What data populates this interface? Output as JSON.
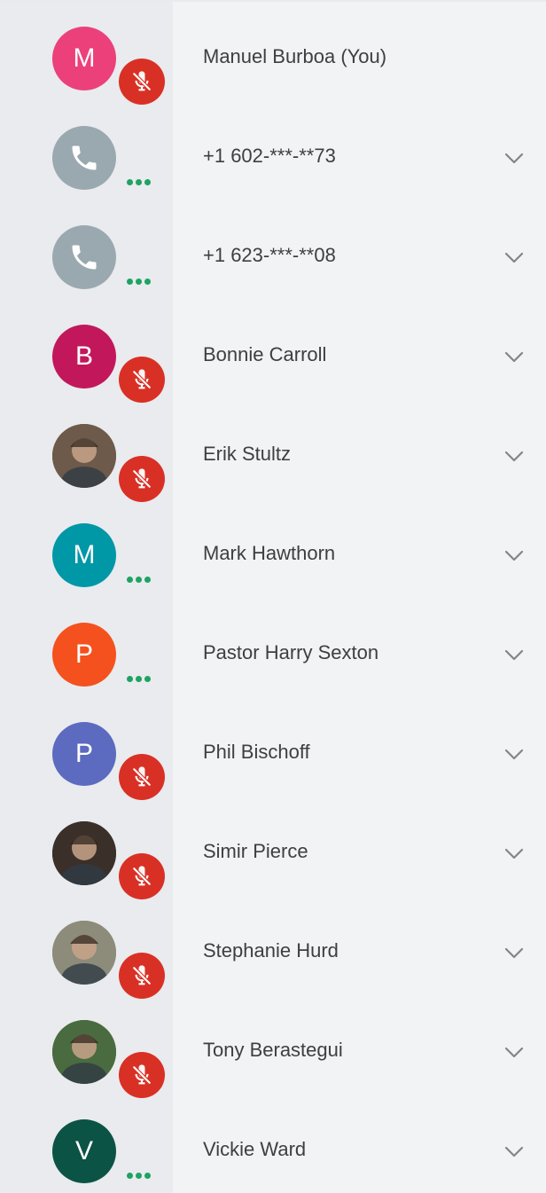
{
  "colors": {
    "panel_bg": "#f1f3f4",
    "gutter_bg": "#e9ebee",
    "muted_red": "#d93025",
    "talking_green": "#1ea362",
    "phone_gray": "#9aa9b0"
  },
  "participants": [
    {
      "name": "Manuel Burboa (You)",
      "avatar_type": "letter",
      "initial": "M",
      "avatar_color": "#ec407a",
      "status": "muted",
      "menu": false
    },
    {
      "name": "+1 602-***-**73",
      "avatar_type": "phone",
      "initial": "",
      "avatar_color": "#9aa9b0",
      "status": "connecting",
      "menu": true
    },
    {
      "name": "+1 623-***-**08",
      "avatar_type": "phone",
      "initial": "",
      "avatar_color": "#9aa9b0",
      "status": "connecting",
      "menu": true
    },
    {
      "name": "Bonnie Carroll",
      "avatar_type": "letter",
      "initial": "B",
      "avatar_color": "#c2185b",
      "status": "muted",
      "menu": true
    },
    {
      "name": "Erik Stultz",
      "avatar_type": "photo",
      "initial": "",
      "avatar_color": "#6d5a4a",
      "status": "muted",
      "menu": true
    },
    {
      "name": "Mark Hawthorn",
      "avatar_type": "letter",
      "initial": "M",
      "avatar_color": "#0097a7",
      "status": "connecting",
      "menu": true
    },
    {
      "name": "Pastor Harry Sexton",
      "avatar_type": "letter",
      "initial": "P",
      "avatar_color": "#f4511e",
      "status": "connecting",
      "menu": true
    },
    {
      "name": "Phil Bischoff",
      "avatar_type": "letter",
      "initial": "P",
      "avatar_color": "#5c6bc0",
      "status": "muted",
      "menu": true
    },
    {
      "name": "Simir Pierce",
      "avatar_type": "photo",
      "initial": "",
      "avatar_color": "#3b2f2a",
      "status": "muted",
      "menu": true
    },
    {
      "name": "Stephanie Hurd",
      "avatar_type": "photo",
      "initial": "",
      "avatar_color": "#8d8b7a",
      "status": "muted",
      "menu": true
    },
    {
      "name": "Tony Berastegui",
      "avatar_type": "photo",
      "initial": "",
      "avatar_color": "#4a6b3f",
      "status": "muted",
      "menu": true
    },
    {
      "name": "Vickie Ward",
      "avatar_type": "letter",
      "initial": "V",
      "avatar_color": "#0b5345",
      "status": "connecting",
      "menu": true
    }
  ]
}
